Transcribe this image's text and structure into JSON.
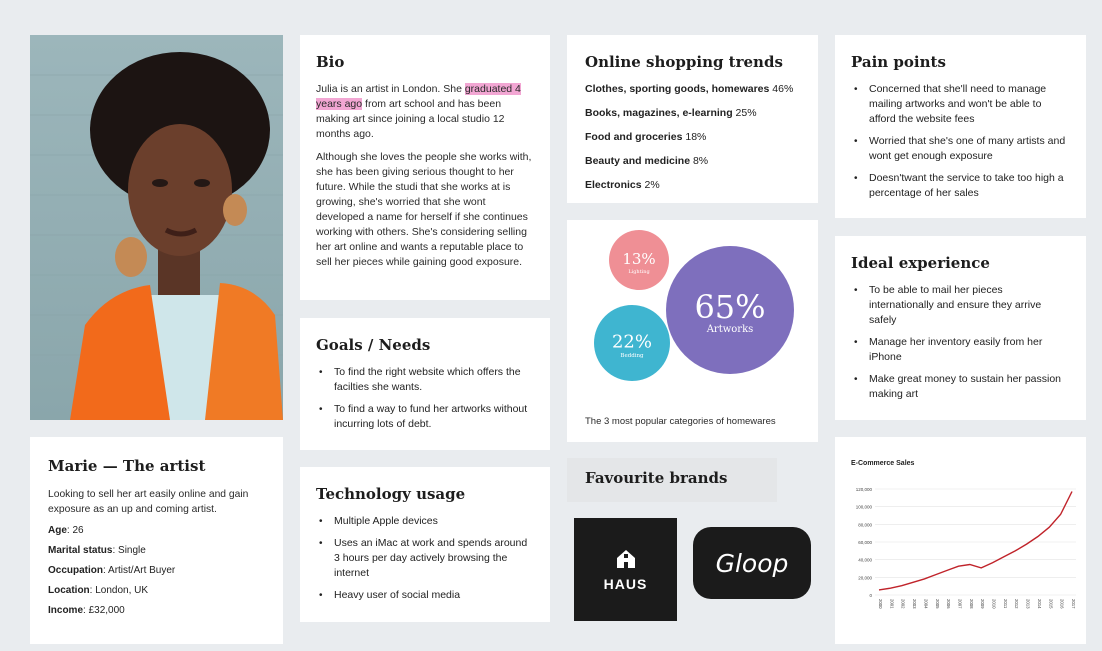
{
  "persona": {
    "name": "Marie — The artist",
    "summary": "Looking to sell her art easily online and gain exposure as an up and coming artist.",
    "details": [
      {
        "label": "Age",
        "value": "26"
      },
      {
        "label": "Marital status",
        "value": "Single"
      },
      {
        "label": "Occupation",
        "value": "Artist/Art Buyer"
      },
      {
        "label": "Location",
        "value": "London, UK"
      },
      {
        "label": "Income",
        "value": "£32,000"
      }
    ]
  },
  "bio": {
    "title": "Bio",
    "p1_before": "Julia is an artist in London. She ",
    "p1_highlight": "graduated 4 years ago",
    "p1_after": " from art school and has been making art since joining a local studio 12 months ago.",
    "p2": "Although she loves the people she works with, she has been giving serious thought to her future. While the studi that she works at is growing,  she's worried that she wont developed a name for herself if she continues working with others. She's considering selling her art online and wants a reputable place to sell her pieces while gaining good exposure."
  },
  "goals": {
    "title": "Goals / Needs",
    "items": [
      "To find the right website which offers the facilties she wants.",
      "To find a way to fund her artworks without incurring lots of debt."
    ]
  },
  "technology": {
    "title": "Technology usage",
    "items": [
      "Multiple Apple devices",
      "Uses an iMac at work and spends around 3 hours per day actively browsing the internet",
      "Heavy user of social media"
    ]
  },
  "trends": {
    "title": "Online shopping trends",
    "items": [
      {
        "label": "Clothes, sporting goods, homewares",
        "value": "46%"
      },
      {
        "label": "Books, magazines, e-learning",
        "value": "25%"
      },
      {
        "label": "Food and groceries",
        "value": "18%"
      },
      {
        "label": "Beauty and medicine",
        "value": "8%"
      },
      {
        "label": "Electronics",
        "value": "2%"
      }
    ]
  },
  "bubbles": {
    "caption": "The 3 most popular categories of homewares",
    "items": [
      {
        "value": "13%",
        "label": "Lighting",
        "color": "#ef8f95"
      },
      {
        "value": "22%",
        "label": "Bedding",
        "color": "#3fb5d0"
      },
      {
        "value": "65%",
        "label": "Artworks",
        "color": "#7e6fbd"
      }
    ]
  },
  "brands": {
    "title": "Favourite brands",
    "items": [
      "HAUS",
      "Gloop"
    ]
  },
  "pain": {
    "title": "Pain points",
    "items": [
      "Concerned that she'll need to manage mailing artworks and won't be able to afford the website fees",
      "Worried that she's one of many artists and wont get enough exposure",
      "Doesn'twant the service to take too high a percentage of her sales"
    ]
  },
  "ideal": {
    "title": "Ideal experience",
    "items": [
      "To be able to mail her pieces internationally and ensure they arrive safely",
      "Manage her inventory easily from her iPhone",
      "Make great money to sustain her passion making art"
    ]
  },
  "chart_data": {
    "type": "line",
    "title": "E-Commerce Sales",
    "x": [
      2000,
      2001,
      2002,
      2003,
      2004,
      2005,
      2006,
      2007,
      2008,
      2009,
      2010,
      2011,
      2012,
      2013,
      2014,
      2015,
      2016,
      2017
    ],
    "series": [
      {
        "values": [
          6000,
          8000,
          11000,
          15000,
          19000,
          24000,
          29000,
          34000,
          36000,
          32000,
          38000,
          45000,
          52000,
          60000,
          69000,
          80000,
          95000,
          122000
        ],
        "color": "#c0232a"
      }
    ],
    "yticks": [
      "120,000",
      "100,000",
      "80,000",
      "60,000",
      "40,000",
      "20,000",
      "0"
    ],
    "ylim": [
      0,
      125000
    ],
    "grid": true
  }
}
